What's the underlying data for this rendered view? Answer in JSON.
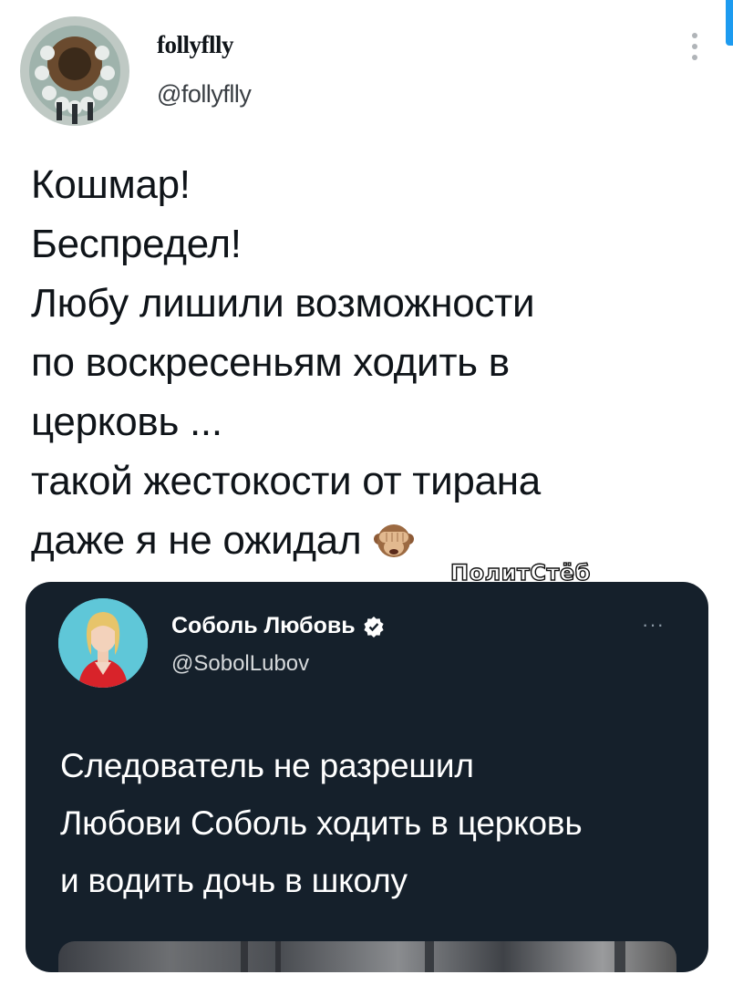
{
  "author": {
    "display_name": "follyflly",
    "handle": "@follyflly",
    "avatar_icon": "avatar-image"
  },
  "tweet": {
    "lines": [
      "Кошмар!",
      "Беспредел!",
      "Любу лишили возможности",
      "по воскресеньям ходить в",
      "церковь ...",
      "такой жестокости от тирана",
      "даже я не ожидал"
    ],
    "emoji": "🙈"
  },
  "watermark": "ПолитСтёб",
  "quoted": {
    "display_name": "Соболь Любовь",
    "handle": "@SobolLubov",
    "more_label": "···",
    "verified_icon": "verified-badge-icon",
    "lines": [
      "Следователь не разрешил",
      "Любови Соболь ходить в церковь",
      "и водить дочь в школу"
    ]
  },
  "colors": {
    "accent": "#1d9bf0",
    "embed_background": "#15202b",
    "text_primary": "#0f1419"
  }
}
